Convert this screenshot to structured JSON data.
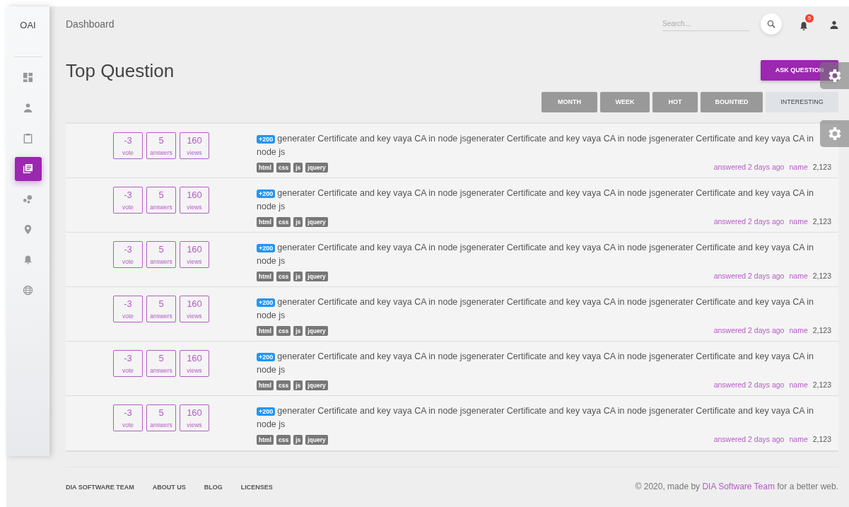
{
  "sidebar": {
    "logo": "OAI",
    "items": [
      {
        "selected": false
      },
      {
        "selected": false
      },
      {
        "selected": false
      },
      {
        "selected": true
      },
      {
        "selected": false
      },
      {
        "selected": false
      },
      {
        "selected": false
      },
      {
        "selected": false
      }
    ]
  },
  "header": {
    "title": "Dashboard",
    "search": {
      "placeholder": "Search..."
    },
    "notifications": {
      "count": "5"
    }
  },
  "page": {
    "title": "Top Question",
    "ask_button": "ASK QUESTION"
  },
  "filters": [
    {
      "label": "MONTH",
      "selected": false
    },
    {
      "label": "WEEK",
      "selected": false
    },
    {
      "label": "HOT",
      "selected": false
    },
    {
      "label": "BOUNTIED",
      "selected": false
    },
    {
      "label": "INTERESTING",
      "selected": true
    }
  ],
  "questions": [
    {
      "votes": "-3",
      "votes_label": "vote",
      "answers": "5",
      "answers_label": "answers",
      "views": "160",
      "views_label": "views",
      "bounty": "+200",
      "title": "generater Certificate and key vaya CA in node jsgenerater Certificate and key vaya CA in node jsgenerater Certificate and key vaya CA in node js",
      "tags": [
        "html",
        "css",
        "js",
        "jquery"
      ],
      "answered": "answered 2 days ago",
      "user": "name",
      "reputation": "2,123"
    },
    {
      "votes": "-3",
      "votes_label": "vote",
      "answers": "5",
      "answers_label": "answers",
      "views": "160",
      "views_label": "views",
      "bounty": "+200",
      "title": "generater Certificate and key vaya CA in node jsgenerater Certificate and key vaya CA in node jsgenerater Certificate and key vaya CA in node js",
      "tags": [
        "html",
        "css",
        "js",
        "jquery"
      ],
      "answered": "answered 2 days ago",
      "user": "name",
      "reputation": "2,123"
    },
    {
      "votes": "-3",
      "votes_label": "vote",
      "answers": "5",
      "answers_label": "answers",
      "views": "160",
      "views_label": "views",
      "bounty": "+200",
      "title": "generater Certificate and key vaya CA in node jsgenerater Certificate and key vaya CA in node jsgenerater Certificate and key vaya CA in node js",
      "tags": [
        "html",
        "css",
        "js",
        "jquery"
      ],
      "answered": "answered 2 days ago",
      "user": "name",
      "reputation": "2,123"
    },
    {
      "votes": "-3",
      "votes_label": "vote",
      "answers": "5",
      "answers_label": "answers",
      "views": "160",
      "views_label": "views",
      "bounty": "+200",
      "title": "generater Certificate and key vaya CA in node jsgenerater Certificate and key vaya CA in node jsgenerater Certificate and key vaya CA in node js",
      "tags": [
        "html",
        "css",
        "js",
        "jquery"
      ],
      "answered": "answered 2 days ago",
      "user": "name",
      "reputation": "2,123"
    },
    {
      "votes": "-3",
      "votes_label": "vote",
      "answers": "5",
      "answers_label": "answers",
      "views": "160",
      "views_label": "views",
      "bounty": "+200",
      "title": "generater Certificate and key vaya CA in node jsgenerater Certificate and key vaya CA in node jsgenerater Certificate and key vaya CA in node js",
      "tags": [
        "html",
        "css",
        "js",
        "jquery"
      ],
      "answered": "answered 2 days ago",
      "user": "name",
      "reputation": "2,123"
    },
    {
      "votes": "-3",
      "votes_label": "vote",
      "answers": "5",
      "answers_label": "answers",
      "views": "160",
      "views_label": "views",
      "bounty": "+200",
      "title": "generater Certificate and key vaya CA in node jsgenerater Certificate and key vaya CA in node jsgenerater Certificate and key vaya CA in node js",
      "tags": [
        "html",
        "css",
        "js",
        "jquery"
      ],
      "answered": "answered 2 days ago",
      "user": "name",
      "reputation": "2,123"
    }
  ],
  "footer": {
    "links": [
      "DIA SOFTWARE TEAM",
      "ABOUT US",
      "BLOG",
      "LICENSES"
    ],
    "copyright_prefix": "© 2020, made by",
    "copyright_link": "DIA Software Team",
    "copyright_suffix": "for a better web."
  }
}
